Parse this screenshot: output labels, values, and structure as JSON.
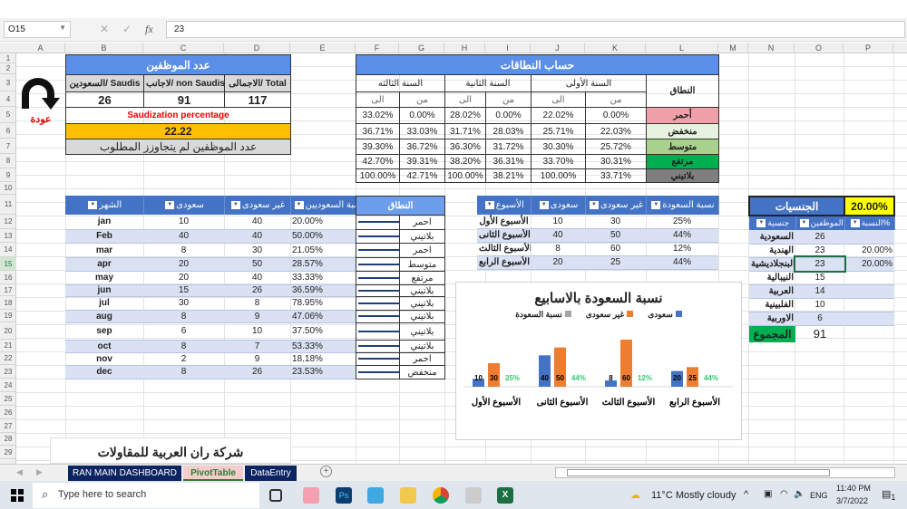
{
  "formula_bar": {
    "name_box": "O15",
    "cancel": "✕",
    "enter": "✓",
    "fx": "fx",
    "value": "23"
  },
  "columns": [
    "A",
    "B",
    "C",
    "D",
    "E",
    "F",
    "G",
    "H",
    "I",
    "J",
    "K",
    "L",
    "M",
    "N",
    "O",
    "P"
  ],
  "rows": [
    "1",
    "2",
    "3",
    "4",
    "5",
    "6",
    "7",
    "8",
    "9",
    "10",
    "11",
    "12",
    "13",
    "14",
    "15",
    "16",
    "17",
    "18",
    "19",
    "20",
    "21",
    "22",
    "23",
    "24",
    "25",
    "26",
    "27",
    "28",
    "29"
  ],
  "back_button": {
    "label": "عودة"
  },
  "employees": {
    "title": "عدد الموظفين",
    "h_saudis": "السعودين/ Saudis",
    "h_non": "لاجانب/ non Saudis",
    "h_total": "الاجمالى/  Total",
    "saudis": "26",
    "non_saudis": "91",
    "total": "117",
    "saudization_label": "Saudization percentage",
    "saudization_value": "22.22",
    "message": "عدد الموظفين لم يتجاوزز المطلوب"
  },
  "bands": {
    "title": "حساب النطاقات",
    "band_header": "النطاق",
    "years": [
      "السنة الثالثه",
      "السنة الثانية",
      "السنة الأولى"
    ],
    "to": "الى",
    "from": "من",
    "rows": [
      {
        "name": "أحمر",
        "color": "#f0a0a8",
        "vals": [
          "33.02%",
          "0.00%",
          "28.02%",
          "0.00%",
          "22.02%",
          "0.00%"
        ]
      },
      {
        "name": "منخفض",
        "color": "#e8f2e0",
        "vals": [
          "36.71%",
          "33.03%",
          "31.71%",
          "28.03%",
          "25.71%",
          "22.03%"
        ]
      },
      {
        "name": "متوسط",
        "color": "#a9d18e",
        "vals": [
          "39.30%",
          "36.72%",
          "36.30%",
          "31.72%",
          "30.30%",
          "25.72%"
        ]
      },
      {
        "name": "مرتفع",
        "color": "#00b050",
        "vals": [
          "42.70%",
          "39.31%",
          "38.20%",
          "36.31%",
          "33.70%",
          "30.31%"
        ]
      },
      {
        "name": "بلاتيني",
        "color": "#7f7f7f",
        "vals": [
          "100.00%",
          "42.71%",
          "100.00%",
          "38.21%",
          "100.00%",
          "33.71%"
        ]
      }
    ]
  },
  "monthly": {
    "headers": [
      "الشهر",
      "سعودى",
      "غير سعودى",
      "نسبة السعوديين"
    ],
    "band_header": "النطاق",
    "rows": [
      [
        "jan",
        "10",
        "40",
        "20.00%",
        "احمر"
      ],
      [
        "Feb",
        "40",
        "40",
        "50.00%",
        "بلاتيني"
      ],
      [
        "mar",
        "8",
        "30",
        "21.05%",
        "احمر"
      ],
      [
        "apr",
        "20",
        "50",
        "28.57%",
        "متوسط"
      ],
      [
        "may",
        "20",
        "40",
        "33.33%",
        "مرتفع"
      ],
      [
        "jun",
        "15",
        "26",
        "36.59%",
        "بلاتيني"
      ],
      [
        "jul",
        "30",
        "8",
        "78.95%",
        "بلاتيني"
      ],
      [
        "aug",
        "8",
        "9",
        "47.06%",
        "بلاتيني"
      ],
      [
        "sep",
        "6",
        "10",
        "37.50%",
        "بلاتيني"
      ],
      [
        "oct",
        "8",
        "7",
        "53.33%",
        "بلاتيني"
      ],
      [
        "nov",
        "2",
        "9",
        "18.18%",
        "احمر"
      ],
      [
        "dec",
        "8",
        "26",
        "23.53%",
        "منخفض"
      ]
    ]
  },
  "weekly": {
    "headers": [
      "الأسبوع",
      "سعودى",
      "غير سعودى",
      "نسبة السعودة"
    ],
    "rows": [
      [
        "الأسبوع الأول",
        "10",
        "30",
        "25%"
      ],
      [
        "الأسبوع الثانى",
        "40",
        "50",
        "44%"
      ],
      [
        "الأسبوع الثالث",
        "8",
        "60",
        "12%"
      ],
      [
        "الأسبوع الرابع",
        "20",
        "25",
        "44%"
      ]
    ]
  },
  "nationalities": {
    "title": "الجنسيات",
    "pct": "20.00%",
    "headers": [
      "جنسية",
      "الموظفين",
      "النسبة%"
    ],
    "rows": [
      [
        "السعودية",
        "26",
        ""
      ],
      [
        "الهندية",
        "23",
        "20.00%"
      ],
      [
        "البنجلاديشية",
        "23",
        "20.00%"
      ],
      [
        "النيبالية",
        "15",
        ""
      ],
      [
        "العربية",
        "14",
        ""
      ],
      [
        "الفلبينية",
        "10",
        ""
      ],
      [
        "الاوربية",
        "6",
        ""
      ]
    ],
    "total_label": "المجموع",
    "total": "91"
  },
  "chart_data": {
    "type": "bar",
    "title": "نسبة السعودة بالاسابيع",
    "categories": [
      "الأسبوع الأول",
      "الأسبوع الثانى",
      "الأسبوع الثالث",
      "الأسبوع الرابع"
    ],
    "series": [
      {
        "name": "سعودى",
        "color": "#4472c4",
        "values": [
          10,
          40,
          8,
          20
        ]
      },
      {
        "name": "غير سعودى",
        "color": "#ed7d31",
        "values": [
          30,
          50,
          60,
          25
        ]
      },
      {
        "name": "نسبة السعودة",
        "color": "#a5a5a5",
        "values": [
          0.25,
          0.44,
          0.12,
          0.44
        ],
        "labels": [
          "25%",
          "44%",
          "12%",
          "44%"
        ]
      }
    ],
    "ylim": [
      0,
      60
    ]
  },
  "logo_text": "شركة ران العربية للمقاولات",
  "sheet_tabs": [
    {
      "label": "RAN MAIN DASHBOARD"
    },
    {
      "label": "PivotTable"
    },
    {
      "label": "DataEntry"
    }
  ],
  "taskbar": {
    "search_placeholder": "Type here to search",
    "weather": "11°C  Mostly cloudy",
    "lang": "ENG",
    "time": "11:40 PM",
    "date": "3/7/2022",
    "notif": "1"
  }
}
